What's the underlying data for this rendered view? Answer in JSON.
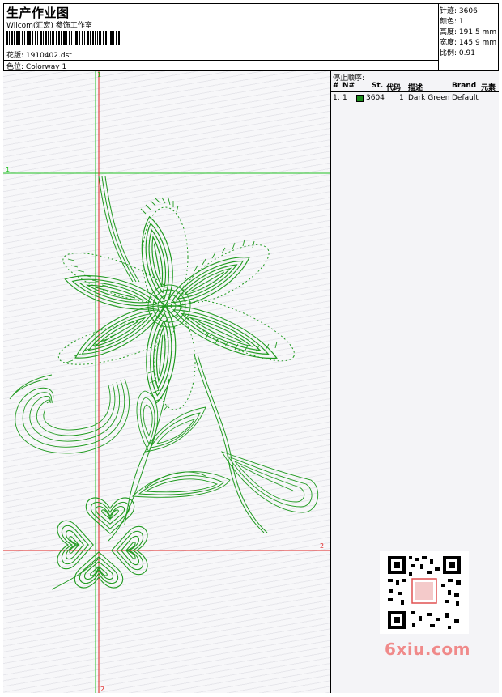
{
  "header": {
    "title": "生产作业图",
    "studio": "Wilcom(汇宏) 参饰工作室",
    "design_label": "花版:",
    "design_value": "1910402.dst",
    "colorway_label": "色位:",
    "colorway_value": "Colorway 1"
  },
  "stats": {
    "stitches_label": "针迹:",
    "stitches_value": "3606",
    "colors_label": "颜色:",
    "colors_value": "1",
    "height_label": "高度:",
    "height_value": "191.5 mm",
    "width_label": "宽度:",
    "width_value": "145.9 mm",
    "scale_label": "比例:",
    "scale_value": "0.91"
  },
  "guides": {
    "v1": "1",
    "h1": "1",
    "h2": "2",
    "v2": "2"
  },
  "stop_sequence": {
    "title": "停止顺序:",
    "columns": [
      "#",
      "N#",
      "St.",
      "代码",
      "描述",
      "Brand",
      "元素"
    ],
    "rows": [
      {
        "index": "1.",
        "n": "1",
        "stitches": "3604",
        "code": "1",
        "description": "Dark Green",
        "brand": "Default",
        "element": "",
        "color": "#1a8a1a"
      }
    ]
  },
  "watermark": "6xiu.com",
  "colors": {
    "thread": "#1f9a1f",
    "guide_green": "#22c022",
    "guide_red": "#e02020"
  }
}
